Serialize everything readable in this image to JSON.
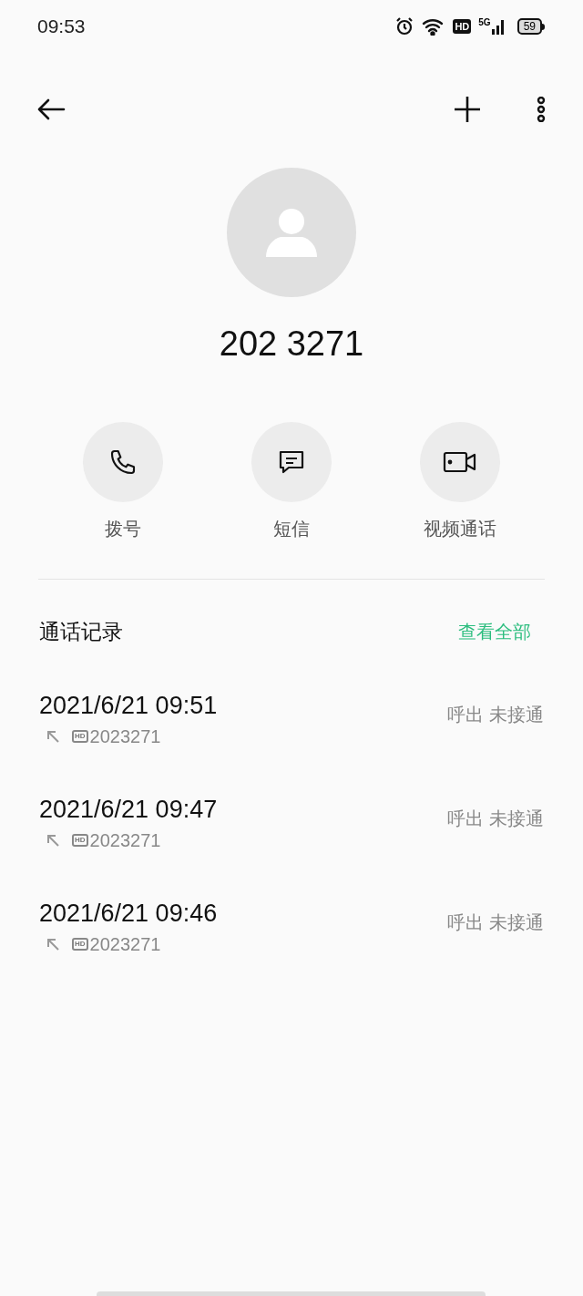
{
  "status_bar": {
    "time": "09:53",
    "hd": "HD",
    "network": "5G",
    "battery": "59"
  },
  "contact": {
    "number": "202 3271"
  },
  "actions": [
    {
      "kind": "phone",
      "label": "拨号"
    },
    {
      "kind": "message",
      "label": "短信"
    },
    {
      "kind": "video",
      "label": "视频通话"
    }
  ],
  "call_log": {
    "title": "通话记录",
    "view_all": "查看全部",
    "entries": [
      {
        "datetime": "2021/6/21 09:51",
        "hd": "HD",
        "number": "2023271",
        "status": "呼出 未接通"
      },
      {
        "datetime": "2021/6/21 09:47",
        "hd": "HD",
        "number": "2023271",
        "status": "呼出 未接通"
      },
      {
        "datetime": "2021/6/21 09:46",
        "hd": "HD",
        "number": "2023271",
        "status": "呼出 未接通"
      }
    ]
  }
}
